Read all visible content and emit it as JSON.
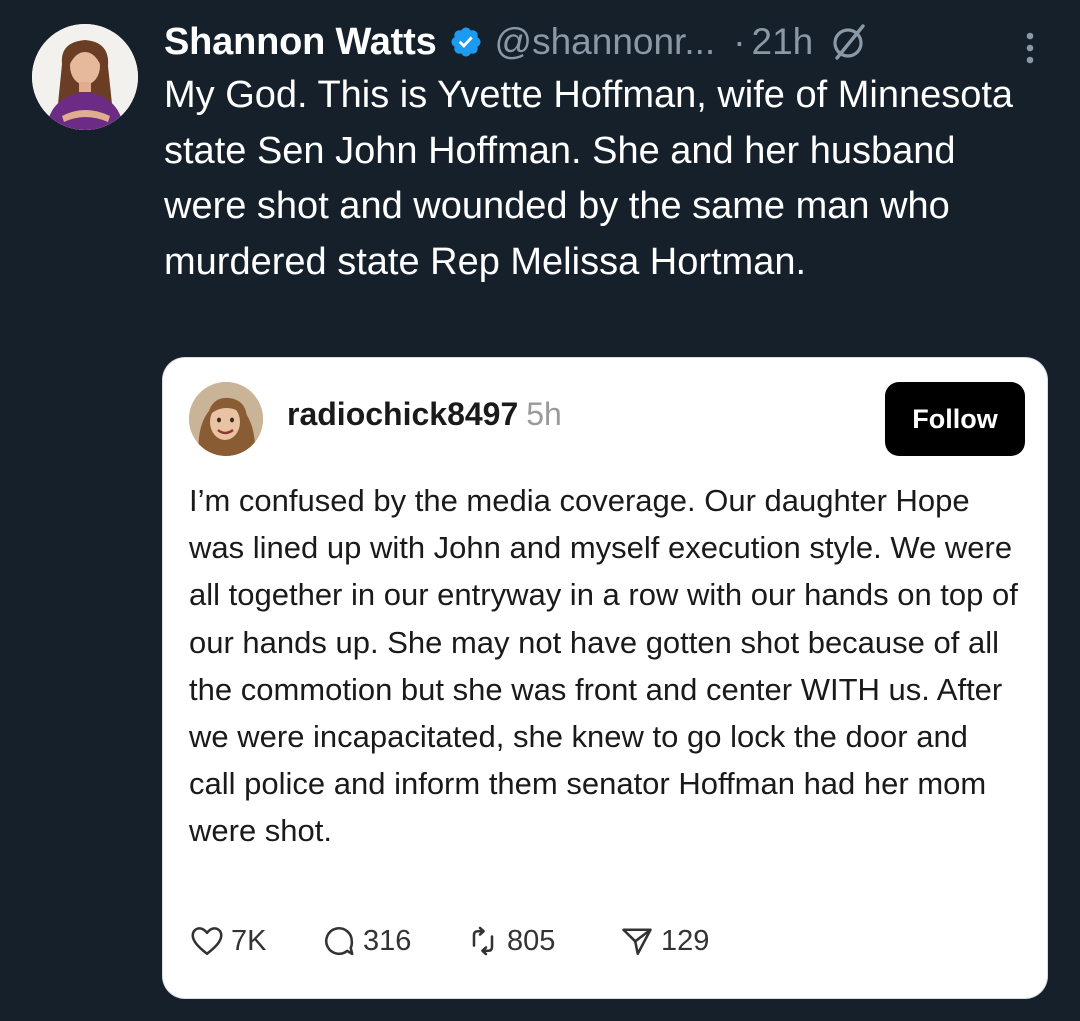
{
  "tweet": {
    "author": {
      "display_name": "Shannon Watts",
      "handle": "@shannonr...",
      "verified": true
    },
    "separator": "·",
    "time": "21h",
    "text": "My God. This is Yvette Hoffman, wife of Minnesota state Sen John Hoffman. She and her husband were shot and wounded by the same man who murdered state Rep Melissa Hortman.",
    "icons": [
      "verified-badge-icon",
      "grok-icon",
      "more-options-icon"
    ]
  },
  "quoted_post": {
    "username": "radiochick8497",
    "time": "5h",
    "follow_label": "Follow",
    "text": "I’m confused by the media coverage. Our daughter Hope was lined up with John and myself execution style. We were all together in our entryway in a row with our hands on top of our hands up.  She may not have gotten shot because of all the commotion but she was front and center WITH us.  After we were incapacitated, she knew to go lock the door and call police and inform them senator Hoffman had her mom were shot.",
    "actions": {
      "likes": "7K",
      "replies": "316",
      "reposts": "805",
      "shares": "129"
    }
  },
  "colors": {
    "background": "#15202b",
    "text_primary": "#ffffff",
    "text_secondary": "#8b98a5",
    "verified_blue": "#1d9bf0",
    "card_background": "#ffffff",
    "follow_button": "#000000"
  }
}
